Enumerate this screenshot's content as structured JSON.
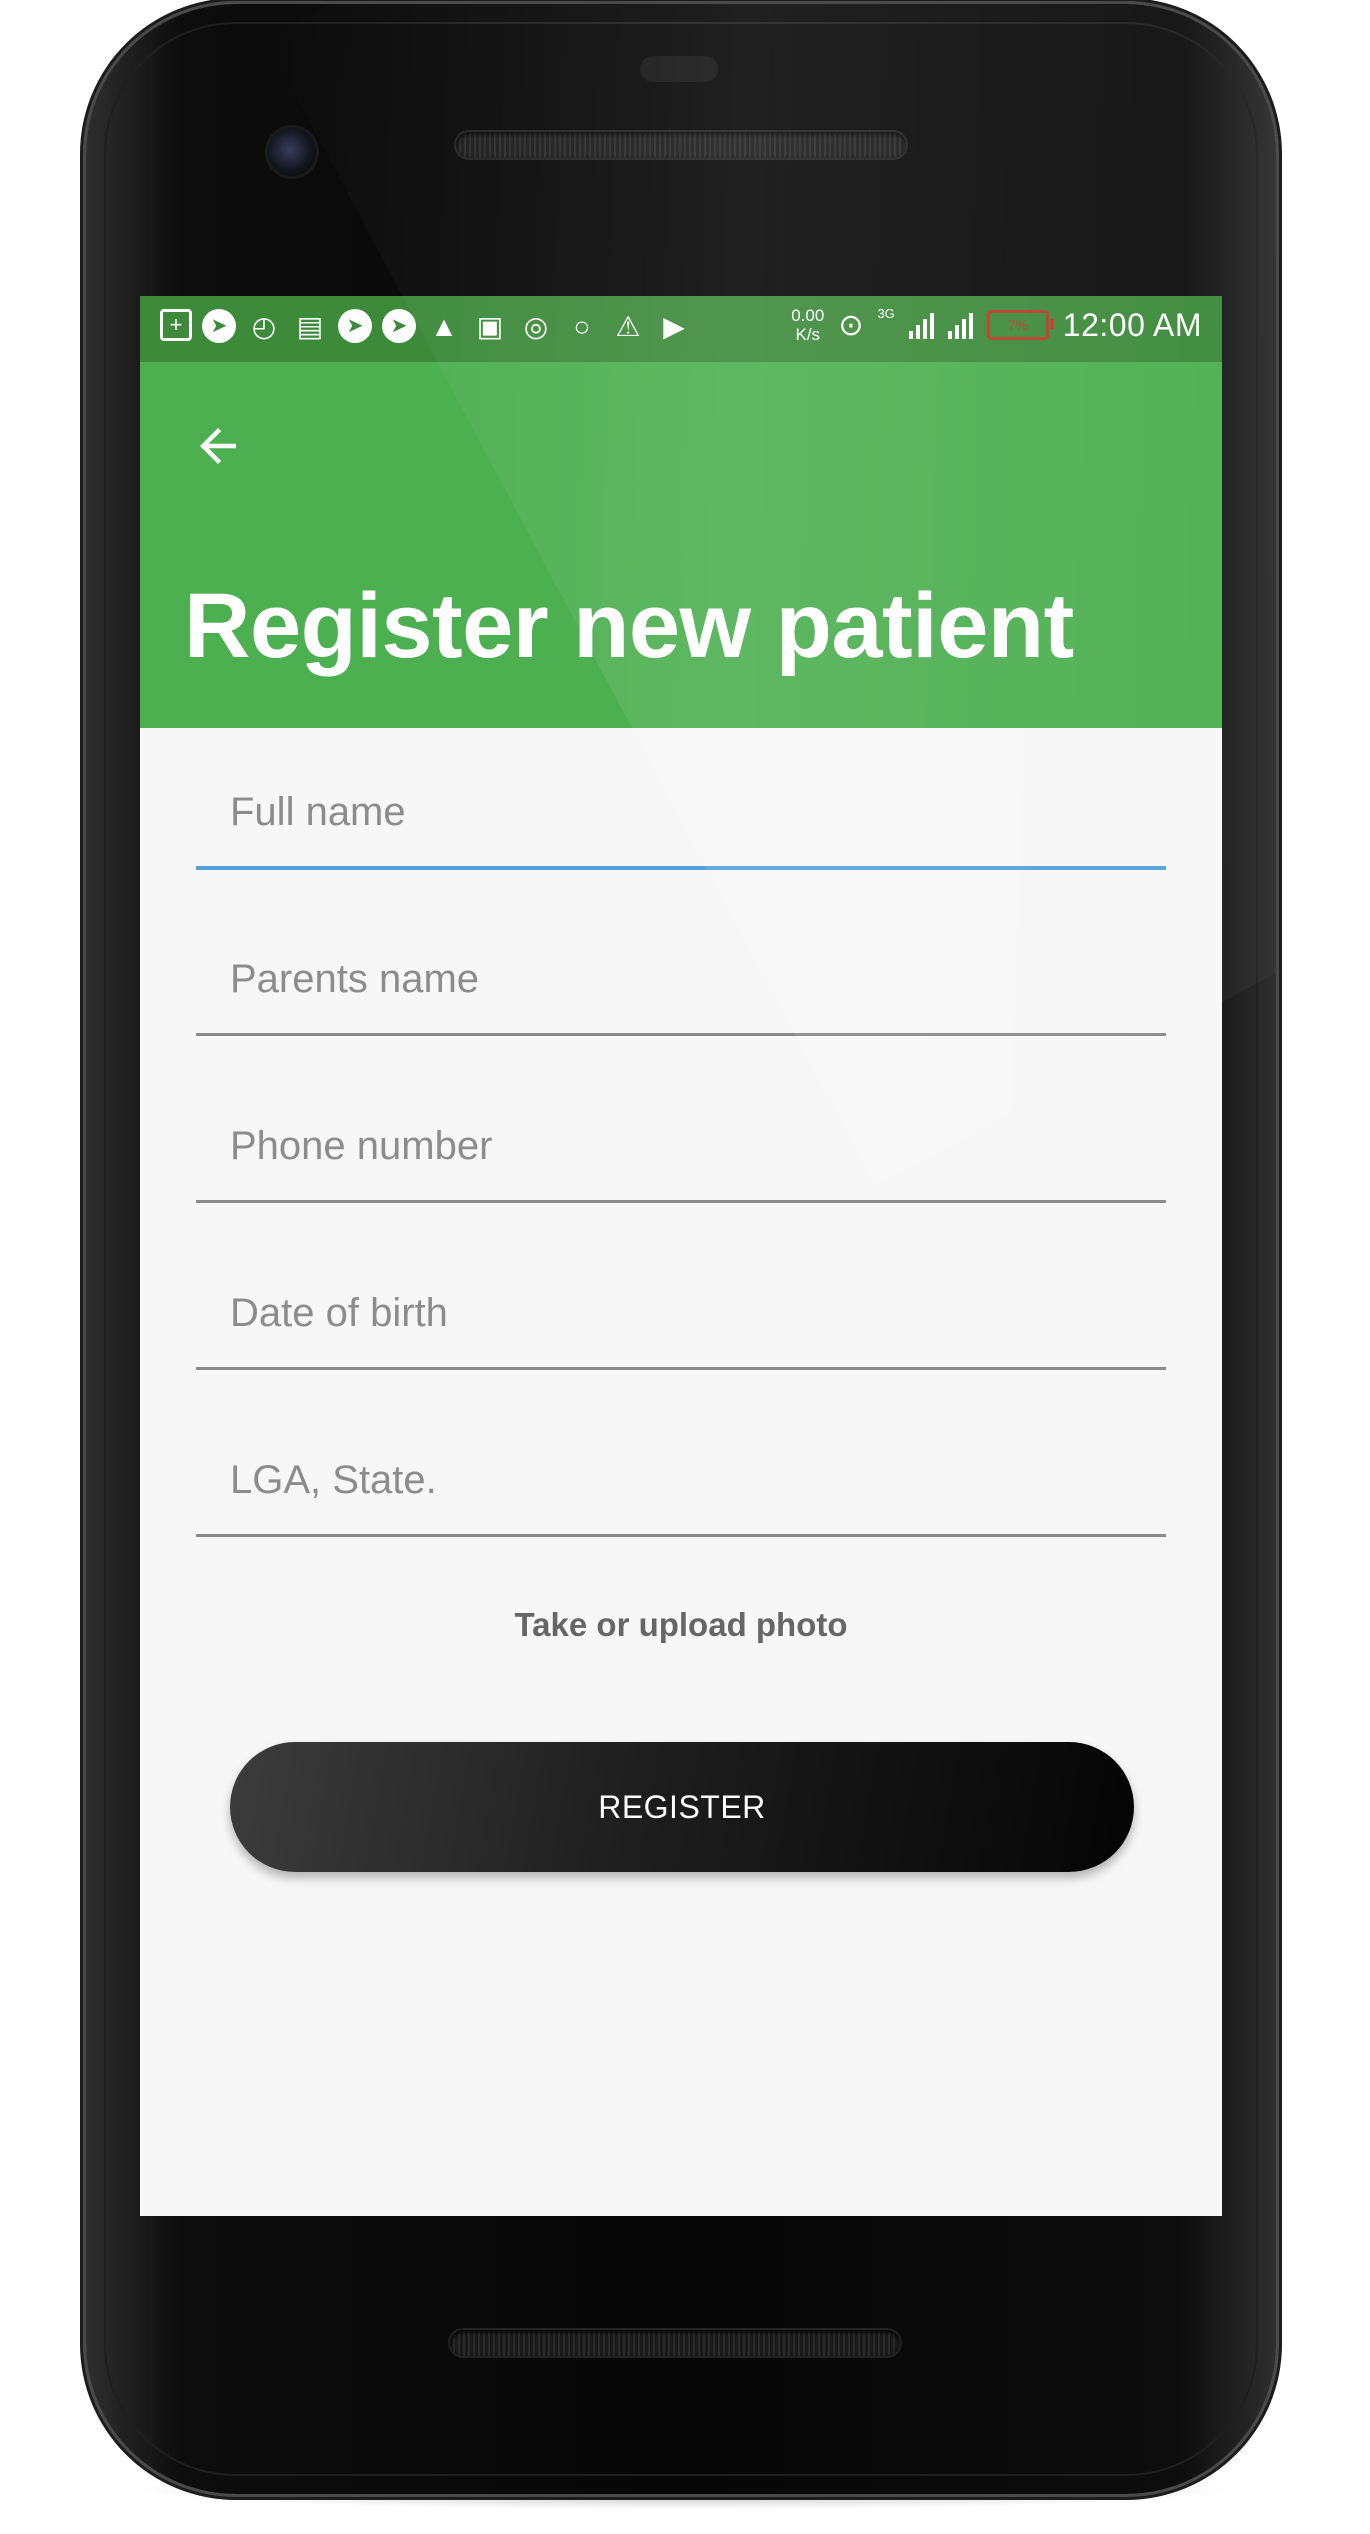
{
  "status_bar": {
    "left_icons": [
      "plus-box-icon",
      "telegram-icon",
      "shirt-icon",
      "message-icon",
      "telegram-icon",
      "telegram-icon",
      "broom-icon",
      "image-icon",
      "broadcast-icon",
      "chat-bubble-icon",
      "warning-icon",
      "youtube-icon"
    ],
    "net_speed_value": "0.00",
    "net_speed_unit": "K/s",
    "network_type": "3G",
    "battery_level": "7%",
    "time": "12:00 AM",
    "accent_color": "#3d8a3b",
    "battery_color": "#c0392b"
  },
  "app_bar": {
    "back_icon": "arrow-left-icon",
    "title": "Register new patient",
    "color": "#4caf50"
  },
  "form": {
    "fields": [
      {
        "placeholder": "Full name",
        "value": "",
        "focused": true
      },
      {
        "placeholder": "Parents name",
        "value": ""
      },
      {
        "placeholder": "Phone number",
        "value": ""
      },
      {
        "placeholder": "Date of birth",
        "value": ""
      },
      {
        "placeholder": "LGA, State.",
        "value": ""
      }
    ],
    "focus_color": "#55a2dc",
    "upload_photo_label": "Take or upload photo",
    "register_label": "REGISTER"
  }
}
